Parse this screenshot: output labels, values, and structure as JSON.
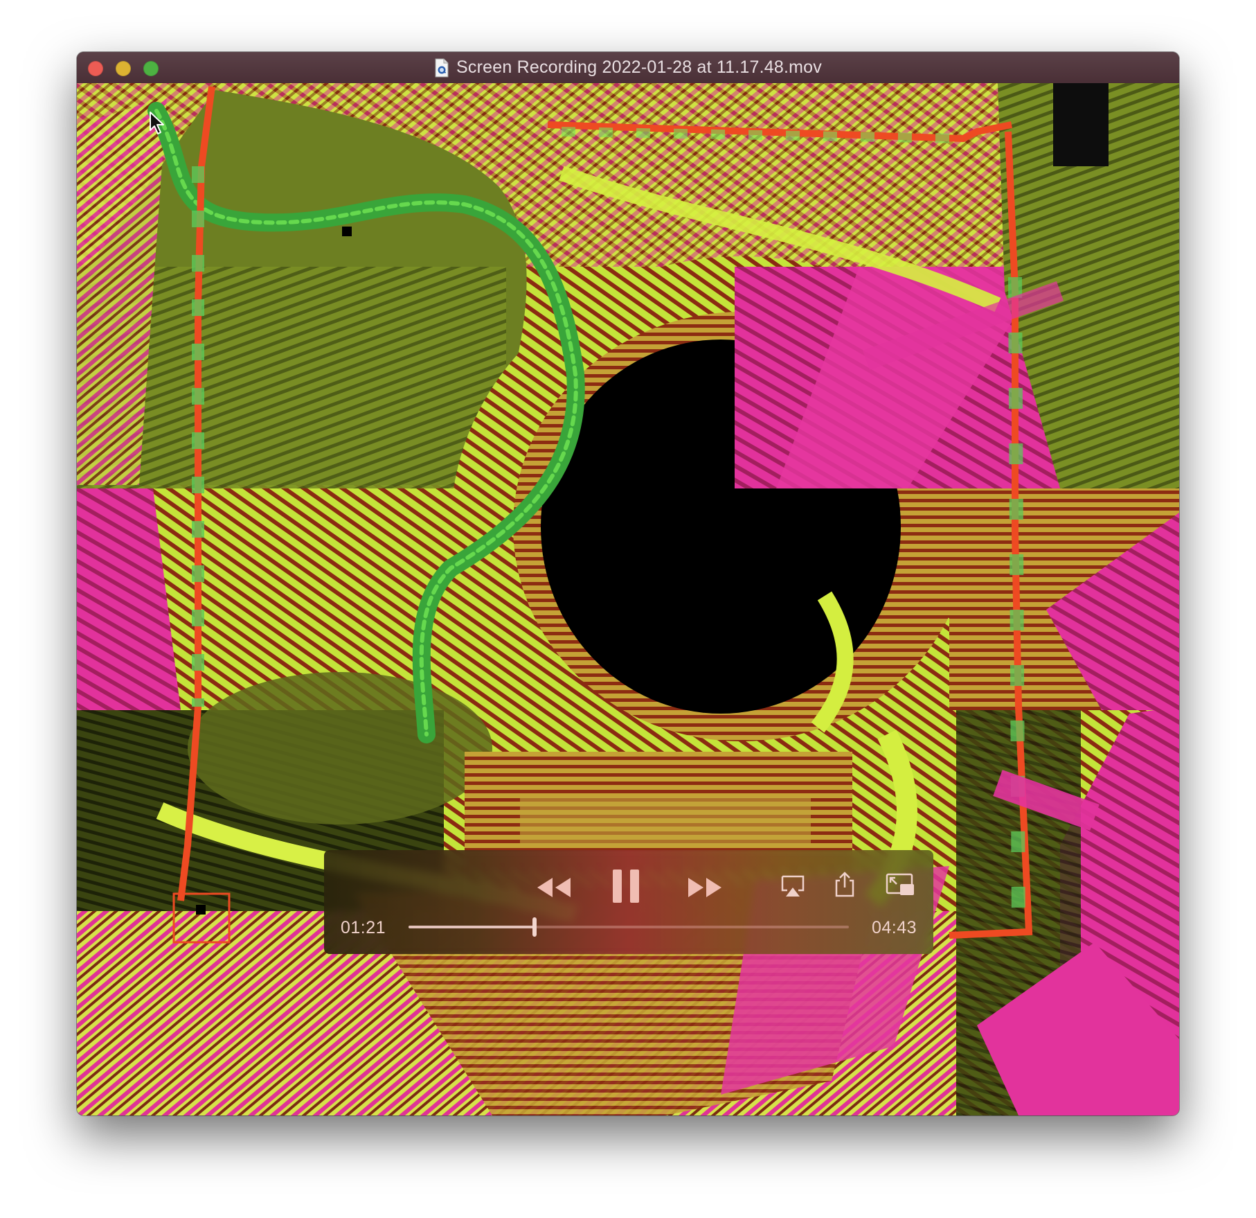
{
  "window": {
    "title": "Screen Recording 2022-01-28 at 11.17.48.mov",
    "title_icon": "quicktime-document-icon"
  },
  "traffic_lights": {
    "close_color": "#ed5c54",
    "minimize_color": "#dcb332",
    "zoom_color": "#4db142"
  },
  "video": {
    "description_colors": {
      "magenta": "#e0309a",
      "lime": "#c8ee3c",
      "olive": "#6b7a1f",
      "green": "#3cb83c",
      "red": "#ee4422",
      "maroon": "#7a1f10"
    }
  },
  "controls": {
    "rewind_icon": "rewind-icon",
    "pause_icon": "pause-icon",
    "fast_forward_icon": "fast-forward-icon",
    "airplay_icon": "airplay-icon",
    "share_icon": "share-icon",
    "pip_icon": "picture-in-picture-icon",
    "current_time": "01:21",
    "duration": "04:43",
    "progress_fraction": 0.286
  }
}
